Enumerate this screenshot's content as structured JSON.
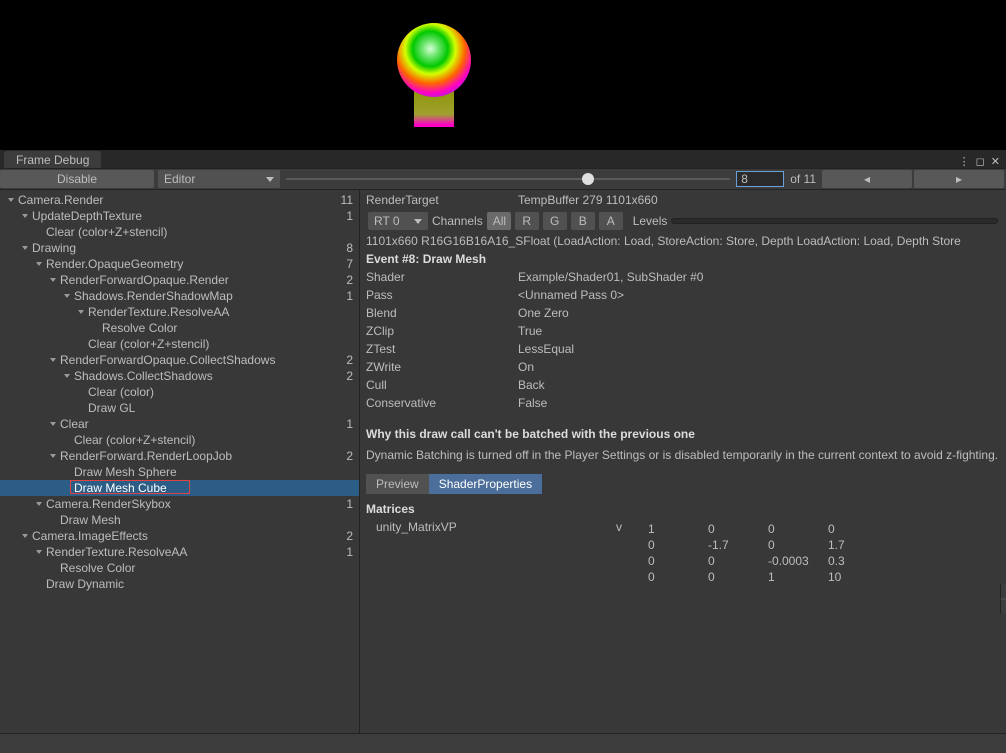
{
  "window": {
    "tab_title": "Frame Debug"
  },
  "toolbar": {
    "disable_label": "Disable",
    "target_dropdown": "Editor",
    "frame_current": "8",
    "frame_total": "of 11",
    "prev_icon": "◂",
    "next_icon": "▸",
    "slider_percent": 68
  },
  "tree": [
    {
      "indent": 0,
      "expand": true,
      "label": "Camera.Render",
      "count": "11"
    },
    {
      "indent": 1,
      "expand": true,
      "label": "UpdateDepthTexture",
      "count": "1"
    },
    {
      "indent": 2,
      "expand": false,
      "label": "Clear (color+Z+stencil)",
      "count": ""
    },
    {
      "indent": 1,
      "expand": true,
      "label": "Drawing",
      "count": "8"
    },
    {
      "indent": 2,
      "expand": true,
      "label": "Render.OpaqueGeometry",
      "count": "7"
    },
    {
      "indent": 3,
      "expand": true,
      "label": "RenderForwardOpaque.Render",
      "count": "2"
    },
    {
      "indent": 4,
      "expand": true,
      "label": "Shadows.RenderShadowMap",
      "count": "1"
    },
    {
      "indent": 5,
      "expand": true,
      "label": "RenderTexture.ResolveAA",
      "count": ""
    },
    {
      "indent": 6,
      "expand": false,
      "label": "Resolve Color",
      "count": ""
    },
    {
      "indent": 5,
      "expand": false,
      "label": "Clear (color+Z+stencil)",
      "count": ""
    },
    {
      "indent": 3,
      "expand": true,
      "label": "RenderForwardOpaque.CollectShadows",
      "count": "2"
    },
    {
      "indent": 4,
      "expand": true,
      "label": "Shadows.CollectShadows",
      "count": "2"
    },
    {
      "indent": 5,
      "expand": false,
      "label": "Clear (color)",
      "count": ""
    },
    {
      "indent": 5,
      "expand": false,
      "label": "Draw GL",
      "count": ""
    },
    {
      "indent": 3,
      "expand": true,
      "label": "Clear",
      "count": "1"
    },
    {
      "indent": 4,
      "expand": false,
      "label": "Clear (color+Z+stencil)",
      "count": ""
    },
    {
      "indent": 3,
      "expand": true,
      "label": "RenderForward.RenderLoopJob",
      "count": "2"
    },
    {
      "indent": 4,
      "expand": false,
      "label": "Draw Mesh Sphere",
      "count": ""
    },
    {
      "indent": 4,
      "expand": false,
      "label": "Draw Mesh Cube",
      "count": "",
      "selected": true,
      "highlighted": true
    },
    {
      "indent": 2,
      "expand": true,
      "label": "Camera.RenderSkybox",
      "count": "1"
    },
    {
      "indent": 3,
      "expand": false,
      "label": "Draw Mesh",
      "count": ""
    },
    {
      "indent": 1,
      "expand": true,
      "label": "Camera.ImageEffects",
      "count": "2"
    },
    {
      "indent": 2,
      "expand": true,
      "label": "RenderTexture.ResolveAA",
      "count": "1"
    },
    {
      "indent": 3,
      "expand": false,
      "label": "Resolve Color",
      "count": ""
    },
    {
      "indent": 2,
      "expand": false,
      "label": "Draw Dynamic",
      "count": ""
    }
  ],
  "details": {
    "render_target_label": "RenderTarget",
    "render_target_value": "TempBuffer 279 1101x660",
    "rt_dropdown": "RT 0",
    "channels_label": "Channels",
    "ch_all": "All",
    "ch_r": "R",
    "ch_g": "G",
    "ch_b": "B",
    "ch_a": "A",
    "levels_label": "Levels",
    "format_line": "1101x660 R16G16B16A16_SFloat (LoadAction: Load, StoreAction: Store, Depth LoadAction: Load, Depth Store",
    "event_title": "Event #8: Draw Mesh",
    "props": [
      {
        "k": "Shader",
        "v": "Example/Shader01, SubShader #0"
      },
      {
        "k": "Pass",
        "v": "<Unnamed Pass 0>"
      },
      {
        "k": "Blend",
        "v": "One Zero"
      },
      {
        "k": "ZClip",
        "v": "True"
      },
      {
        "k": "ZTest",
        "v": "LessEqual"
      },
      {
        "k": "ZWrite",
        "v": "On"
      },
      {
        "k": "Cull",
        "v": "Back"
      },
      {
        "k": "Conservative",
        "v": "False"
      }
    ],
    "batch_title": "Why this draw call can't be batched with the previous one",
    "batch_reason": "Dynamic Batching is turned off in the Player Settings or is disabled temporarily in the current context to avoid z-fighting.",
    "tab_preview": "Preview",
    "tab_shaderprops": "ShaderProperties",
    "matrices_label": "Matrices",
    "matrix": {
      "name": "unity_MatrixVP",
      "tag": "v",
      "rows": [
        [
          "1",
          "0",
          "0",
          "0"
        ],
        [
          "0",
          "-1.7",
          "0",
          "1.7"
        ],
        [
          "0",
          "0",
          "-0.0003",
          "0.3"
        ],
        [
          "0",
          "0",
          "1",
          "10"
        ]
      ]
    }
  }
}
